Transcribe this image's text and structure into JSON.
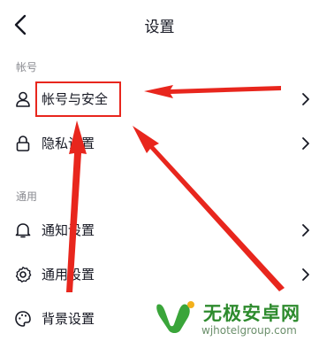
{
  "header": {
    "title": "设置"
  },
  "sections": [
    {
      "label": "帐号"
    },
    {
      "label": "通用"
    }
  ],
  "rows": [
    {
      "label": "帐号与安全",
      "icon": "person-icon"
    },
    {
      "label": "隐私设置",
      "icon": "lock-icon"
    },
    {
      "label": "通知设置",
      "icon": "bell-icon"
    },
    {
      "label": "通用设置",
      "icon": "gear-icon"
    },
    {
      "label": "背景设置",
      "icon": "palette-icon"
    }
  ],
  "annotation": {
    "color": "#e8261d"
  },
  "watermark": {
    "brand": "无极安卓网",
    "url": "wjhotelgroup.com"
  }
}
